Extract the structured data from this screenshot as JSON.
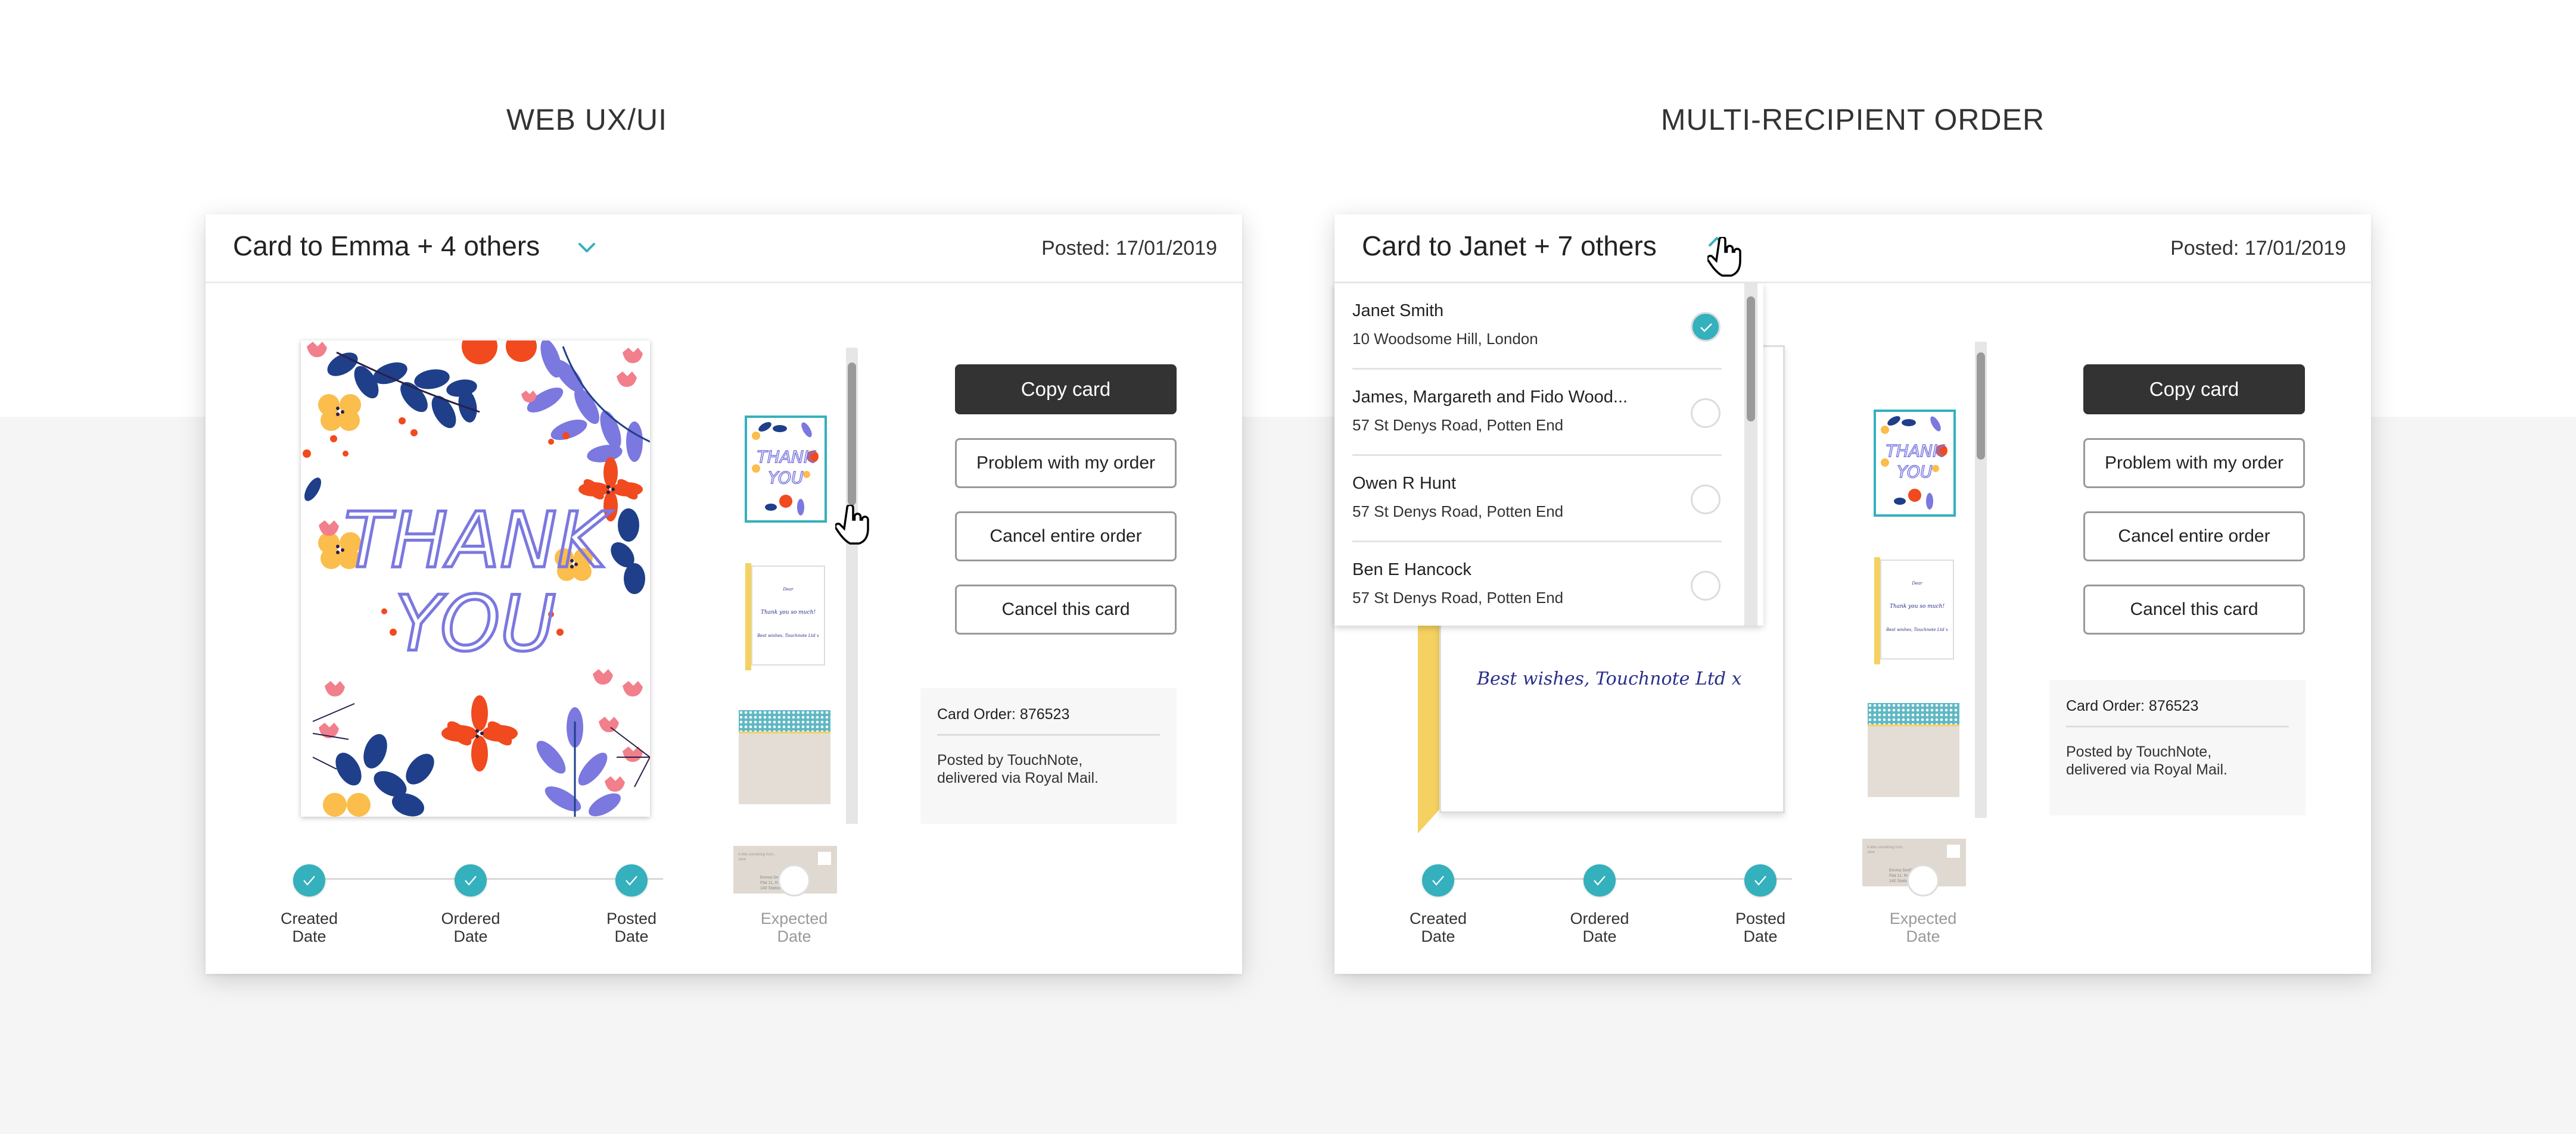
{
  "sections": {
    "left_title": "WEB UX/UI",
    "right_title": "MULTI-RECIPIENT ORDER"
  },
  "colors": {
    "accent_teal": "#35b0bd",
    "primary_button": "#333333",
    "envelope_flap_yellow": "#f4d160",
    "card_text_purple": "#7b78e0"
  },
  "left_panel": {
    "header": {
      "title": "Card to Emma + 4 others",
      "toggle_icon": "chevron-down-icon",
      "posted": "Posted: 17/01/2019"
    },
    "card_front_text_line1": "THANK",
    "card_front_text_line2": "YOU",
    "thumbnails": [
      {
        "label": "card-front",
        "text1": "THANK",
        "text2": "YOU",
        "selected": true
      },
      {
        "label": "card-inside",
        "greeting": "Dear",
        "message": "Thank you so much!",
        "signoff": "Best wishes, Touchnote Ltd x"
      },
      {
        "label": "envelope-back"
      },
      {
        "label": "envelope-front",
        "sender_line1": "A little something from...",
        "sender_line2": "Jane",
        "recipient_line1": "Emma Smith,",
        "recipient_line2": "Flat 11, Roma corte",
        "recipient_line3": "140 Station Road"
      }
    ],
    "thumbnail_scroll_position": 0.2,
    "buttons": {
      "copy": "Copy card",
      "problem": "Problem with my order",
      "cancel_order": "Cancel entire order",
      "cancel_card": "Cancel this card"
    },
    "order_box": {
      "order_number": "Card Order: 876523",
      "note_line1": "Posted by TouchNote,",
      "note_line2": "delivered via Royal Mail."
    },
    "progress": [
      {
        "line1": "Created",
        "line2": "Date",
        "done": true
      },
      {
        "line1": "Ordered",
        "line2": "Date",
        "done": true
      },
      {
        "line1": "Posted",
        "line2": "Date",
        "done": true
      },
      {
        "line1": "Expected",
        "line2": "Date",
        "done": false
      }
    ]
  },
  "right_panel": {
    "header": {
      "title": "Card to Janet + 7 others",
      "toggle_icon": "chevron-up-icon",
      "posted": "Posted: 17/01/2019"
    },
    "dropdown": {
      "recipients": [
        {
          "name": "Janet Smith",
          "address": "10 Woodsome Hill, London",
          "selected": true
        },
        {
          "name": "James, Margareth and Fido Wood...",
          "address": "57 St Denys Road, Potten End",
          "selected": false
        },
        {
          "name": "Owen R Hunt",
          "address": "57 St Denys Road, Potten End",
          "selected": false
        },
        {
          "name": "Ben E Hancock",
          "address": "57 St Denys Road, Potten End",
          "selected": false
        }
      ]
    },
    "card_inside_message": "Best wishes, Touchnote Ltd x",
    "thumbnails": [
      {
        "label": "card-front",
        "text1": "THANK",
        "text2": "YOU",
        "selected": true
      },
      {
        "label": "card-inside",
        "greeting": "Dear",
        "message": "Thank you so much!",
        "signoff": "Best wishes, Touchnote Ltd x"
      },
      {
        "label": "envelope-back"
      },
      {
        "label": "envelope-front",
        "sender_line1": "A little something from...",
        "sender_line2": "Jane",
        "recipient_line1": "Emma Smith,",
        "recipient_line2": "Flat 11, Roma corte",
        "recipient_line3": "140 Station Road"
      }
    ],
    "thumbnail_scroll_position": 0.0,
    "buttons": {
      "copy": "Copy card",
      "problem": "Problem with my order",
      "cancel_order": "Cancel entire order",
      "cancel_card": "Cancel this card"
    },
    "order_box": {
      "order_number": "Card Order: 876523",
      "note_line1": "Posted by TouchNote,",
      "note_line2": "delivered via Royal Mail."
    },
    "progress": [
      {
        "line1": "Created",
        "line2": "Date",
        "done": true
      },
      {
        "line1": "Ordered",
        "line2": "Date",
        "done": true
      },
      {
        "line1": "Posted",
        "line2": "Date",
        "done": true
      },
      {
        "line1": "Expected",
        "line2": "Date",
        "done": false
      }
    ]
  }
}
